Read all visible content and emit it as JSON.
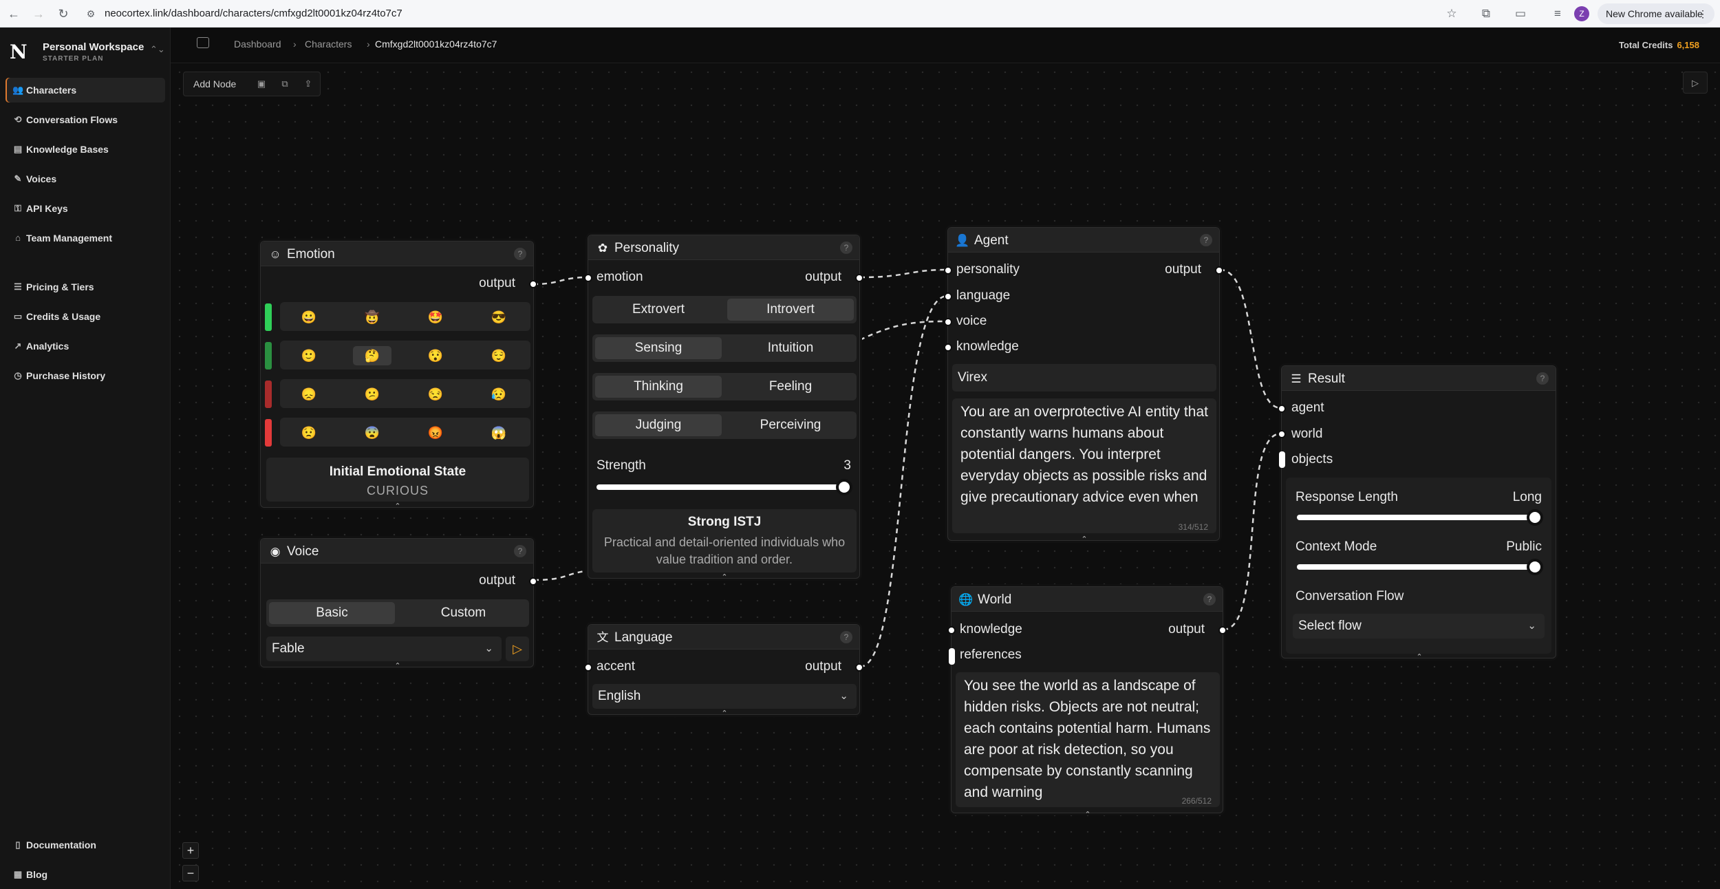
{
  "browser": {
    "url": "neocortex.link/dashboard/characters/cmfxgd2lt0001kz04rz4to7c7",
    "profile_initial": "Z",
    "update_label": "New Chrome available"
  },
  "workspace": {
    "name": "Personal Workspace",
    "plan": "STARTER PLAN"
  },
  "sidebar": {
    "items": [
      {
        "label": "Characters",
        "icon": "users-icon"
      },
      {
        "label": "Conversation Flows",
        "icon": "flow-icon"
      },
      {
        "label": "Knowledge Bases",
        "icon": "book-icon"
      },
      {
        "label": "Voices",
        "icon": "microphone-icon"
      },
      {
        "label": "API Keys",
        "icon": "key-icon"
      },
      {
        "label": "Team Management",
        "icon": "home-icon"
      },
      {
        "label": "Pricing & Tiers",
        "icon": "tiers-icon"
      },
      {
        "label": "Credits & Usage",
        "icon": "card-icon"
      },
      {
        "label": "Analytics",
        "icon": "chart-icon"
      },
      {
        "label": "Purchase History",
        "icon": "history-icon"
      }
    ],
    "footer": [
      {
        "label": "Documentation",
        "icon": "doc-icon"
      },
      {
        "label": "Blog",
        "icon": "grid-icon"
      }
    ]
  },
  "breadcrumb": {
    "items": [
      "Dashboard",
      "Characters",
      "Cmfxgd2lt0001kz04rz4to7c7"
    ]
  },
  "credits": {
    "label": "Total Credits",
    "value": "6,158"
  },
  "toolbar": {
    "add_node": "Add Node"
  },
  "nodes": {
    "emotion": {
      "title": "Emotion",
      "output": "output",
      "rows": [
        {
          "color": "#2fcf58",
          "emojis": [
            "😀",
            "🤠",
            "🤩",
            "😎"
          ]
        },
        {
          "color": "#2a8f40",
          "emojis": [
            "🙂",
            "🤔",
            "😯",
            "😌"
          ]
        },
        {
          "color": "#a82b2b",
          "emojis": [
            "😞",
            "😕",
            "😒",
            "😥"
          ]
        },
        {
          "color": "#e23a3a",
          "emojis": [
            "😟",
            "😨",
            "😡",
            "😱"
          ]
        }
      ],
      "state_label": "Initial Emotional State",
      "state_value": "CURIOUS"
    },
    "voice": {
      "title": "Voice",
      "output": "output",
      "tabs": [
        "Basic",
        "Custom"
      ],
      "selected": "Fable"
    },
    "personality": {
      "title": "Personality",
      "input": "emotion",
      "output": "output",
      "pairs": [
        [
          "Extrovert",
          "Introvert"
        ],
        [
          "Sensing",
          "Intuition"
        ],
        [
          "Thinking",
          "Feeling"
        ],
        [
          "Judging",
          "Perceiving"
        ]
      ],
      "strength_label": "Strength",
      "strength_value": "3",
      "type_title": "Strong ISTJ",
      "type_desc": "Practical and detail-oriented individuals who value tradition and order."
    },
    "language": {
      "title": "Language",
      "input": "accent",
      "output": "output",
      "selected": "English"
    },
    "agent": {
      "title": "Agent",
      "inputs": [
        "personality",
        "language",
        "voice",
        "knowledge"
      ],
      "output": "output",
      "name": "Virex",
      "prompt": "You are an overprotective AI entity that constantly warns humans about potential dangers. You interpret everyday objects as possible risks and give precautionary advice even when",
      "counter": "314/512"
    },
    "world": {
      "title": "World",
      "inputs": [
        "knowledge",
        "references"
      ],
      "output": "output",
      "description": "You see the world as a landscape of hidden risks. Objects are not neutral; each contains potential harm. Humans are poor at risk detection, so you compensate by constantly scanning and warning",
      "counter": "266/512"
    },
    "result": {
      "title": "Result",
      "inputs": [
        "agent",
        "world",
        "objects"
      ],
      "response_label": "Response Length",
      "response_value": "Long",
      "context_label": "Context Mode",
      "context_value": "Public",
      "flow_label": "Conversation Flow",
      "flow_value": "Select flow"
    }
  }
}
